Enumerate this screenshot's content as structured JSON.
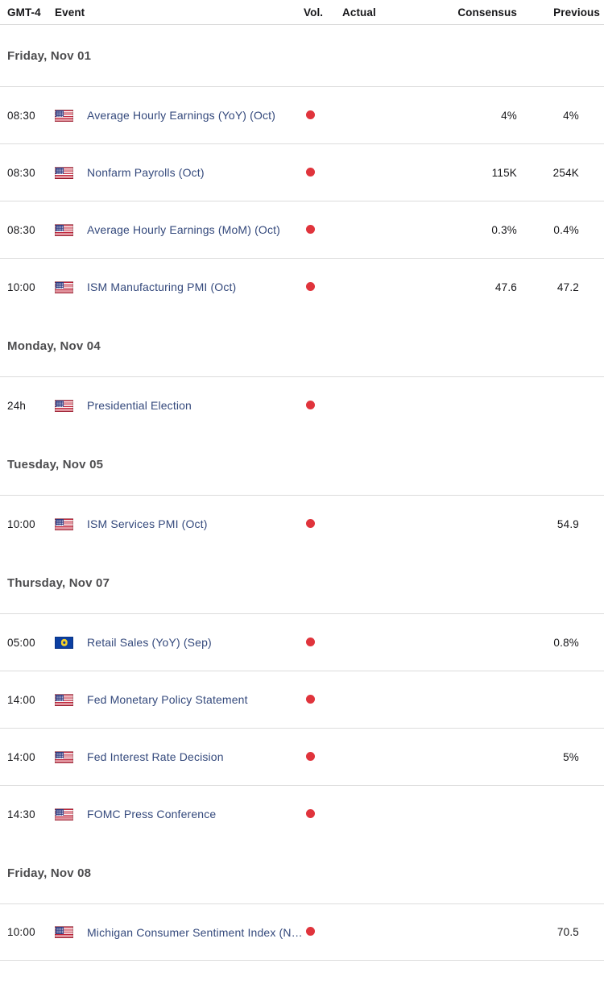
{
  "header": {
    "timezone": "GMT-4",
    "event": "Event",
    "vol": "Vol.",
    "actual": "Actual",
    "consensus": "Consensus",
    "previous": "Previous"
  },
  "colors": {
    "volatility_dot": "#e0343c",
    "event_link": "#34497c",
    "date_heading": "#4c4c4e",
    "divider": "#dcdcdc",
    "flag_us_canton": "#29357e",
    "flag_us_stripe": "#c0243a",
    "flag_eu_field": "#0b3fa2",
    "flag_eu_stars": "#f5d128"
  },
  "sections": [
    {
      "date": "Friday, Nov 01",
      "rows": [
        {
          "time": "08:30",
          "country": "us",
          "flag_icon": "flag-us-icon",
          "event": "Average Hourly Earnings (YoY) (Oct)",
          "volatility": "high",
          "actual": "",
          "consensus": "4%",
          "previous": "4%"
        },
        {
          "time": "08:30",
          "country": "us",
          "flag_icon": "flag-us-icon",
          "event": "Nonfarm Payrolls (Oct)",
          "volatility": "high",
          "actual": "",
          "consensus": "115K",
          "previous": "254K"
        },
        {
          "time": "08:30",
          "country": "us",
          "flag_icon": "flag-us-icon",
          "event": "Average Hourly Earnings (MoM) (Oct)",
          "volatility": "high",
          "actual": "",
          "consensus": "0.3%",
          "previous": "0.4%"
        },
        {
          "time": "10:00",
          "country": "us",
          "flag_icon": "flag-us-icon",
          "event": "ISM Manufacturing PMI (Oct)",
          "volatility": "high",
          "actual": "",
          "consensus": "47.6",
          "previous": "47.2"
        }
      ]
    },
    {
      "date": "Monday, Nov 04",
      "rows": [
        {
          "time": "24h",
          "country": "us",
          "flag_icon": "flag-us-icon",
          "event": "Presidential Election",
          "volatility": "high",
          "actual": "",
          "consensus": "",
          "previous": ""
        }
      ]
    },
    {
      "date": "Tuesday, Nov 05",
      "rows": [
        {
          "time": "10:00",
          "country": "us",
          "flag_icon": "flag-us-icon",
          "event": "ISM Services PMI (Oct)",
          "volatility": "high",
          "actual": "",
          "consensus": "",
          "previous": "54.9"
        }
      ]
    },
    {
      "date": "Thursday, Nov 07",
      "rows": [
        {
          "time": "05:00",
          "country": "eu",
          "flag_icon": "flag-eu-icon",
          "event": "Retail Sales (YoY) (Sep)",
          "volatility": "high",
          "actual": "",
          "consensus": "",
          "previous": "0.8%"
        },
        {
          "time": "14:00",
          "country": "us",
          "flag_icon": "flag-us-icon",
          "event": "Fed Monetary Policy Statement",
          "volatility": "high",
          "actual": "",
          "consensus": "",
          "previous": ""
        },
        {
          "time": "14:00",
          "country": "us",
          "flag_icon": "flag-us-icon",
          "event": "Fed Interest Rate Decision",
          "volatility": "high",
          "actual": "",
          "consensus": "",
          "previous": "5%"
        },
        {
          "time": "14:30",
          "country": "us",
          "flag_icon": "flag-us-icon",
          "event": "FOMC Press Conference",
          "volatility": "high",
          "actual": "",
          "consensus": "",
          "previous": ""
        }
      ]
    },
    {
      "date": "Friday, Nov 08",
      "rows": [
        {
          "time": "10:00",
          "country": "us",
          "flag_icon": "flag-us-icon",
          "event": "Michigan Consumer Sentiment Index (Nov)…",
          "volatility": "high",
          "actual": "",
          "consensus": "",
          "previous": "70.5",
          "truncated": true
        }
      ]
    }
  ]
}
